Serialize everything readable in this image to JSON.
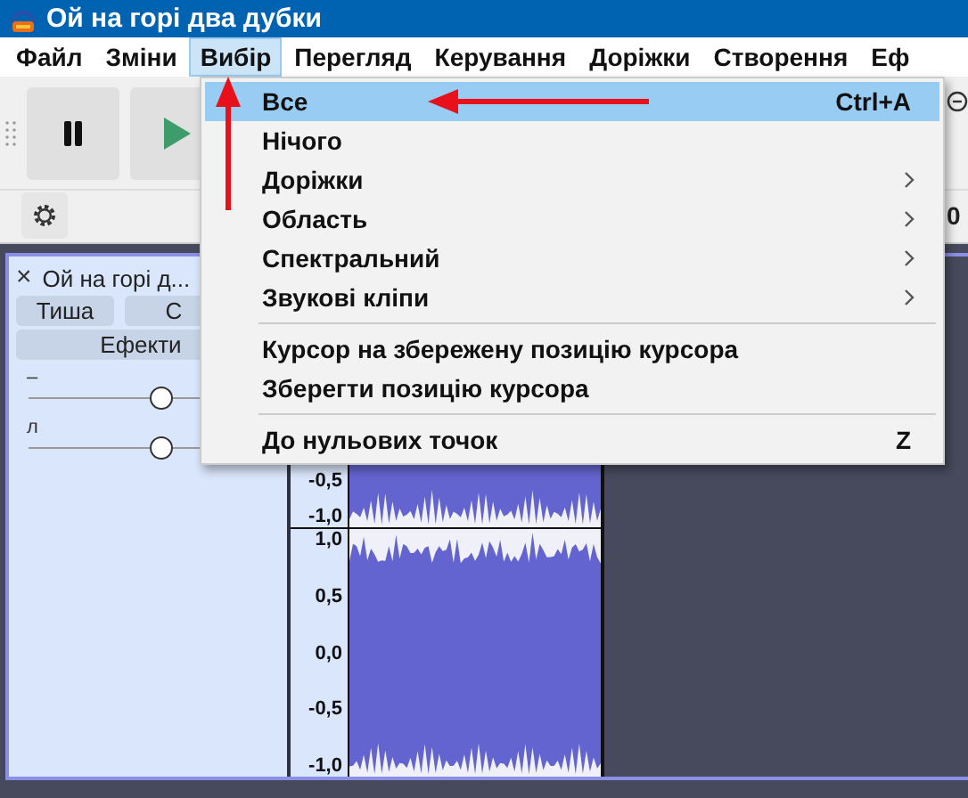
{
  "window": {
    "title": "Ой на горі два дубки"
  },
  "menu_bar": [
    {
      "label": "Файл",
      "selected": false
    },
    {
      "label": "Зміни",
      "selected": false
    },
    {
      "label": "Вибір",
      "selected": true
    },
    {
      "label": "Перегляд",
      "selected": false
    },
    {
      "label": "Керування",
      "selected": false
    },
    {
      "label": "Доріжки",
      "selected": false
    },
    {
      "label": "Створення",
      "selected": false
    },
    {
      "label": "Еф",
      "selected": false
    }
  ],
  "menu": {
    "groups": [
      [
        {
          "label": "Все",
          "shortcut": "Ctrl+A",
          "submenu": false,
          "selected": true
        },
        {
          "label": "Нічого",
          "submenu": false,
          "selected": false
        },
        {
          "label": "Доріжки",
          "submenu": true,
          "selected": false
        },
        {
          "label": "Область",
          "submenu": true,
          "selected": false
        },
        {
          "label": "Спектральний",
          "submenu": true,
          "selected": false
        },
        {
          "label": "Звукові кліпи",
          "submenu": true,
          "selected": false
        }
      ],
      [
        {
          "label": "Курсор на збережену позицію курсора",
          "submenu": false,
          "selected": false
        },
        {
          "label": "Зберегти позицію курсора",
          "submenu": false,
          "selected": false
        }
      ],
      [
        {
          "label": "До нульових точок",
          "shortcut": "Z",
          "submenu": false,
          "selected": false
        }
      ]
    ]
  },
  "toolbar": {
    "right_reading": "0"
  },
  "track": {
    "close": "×",
    "name": "Ой на горі д...",
    "buttons": [
      "Тиша",
      "С"
    ],
    "effects_button": "Ефекти",
    "sliders": [
      {
        "label": "–",
        "level": 0.5
      },
      {
        "label": "л",
        "level": 0.5
      }
    ]
  },
  "ruler": {
    "upper": [
      "-0,5",
      "-1,0"
    ],
    "lower": [
      "1,0",
      "0,5",
      "0,0",
      "-0,5",
      "-1,0"
    ]
  }
}
